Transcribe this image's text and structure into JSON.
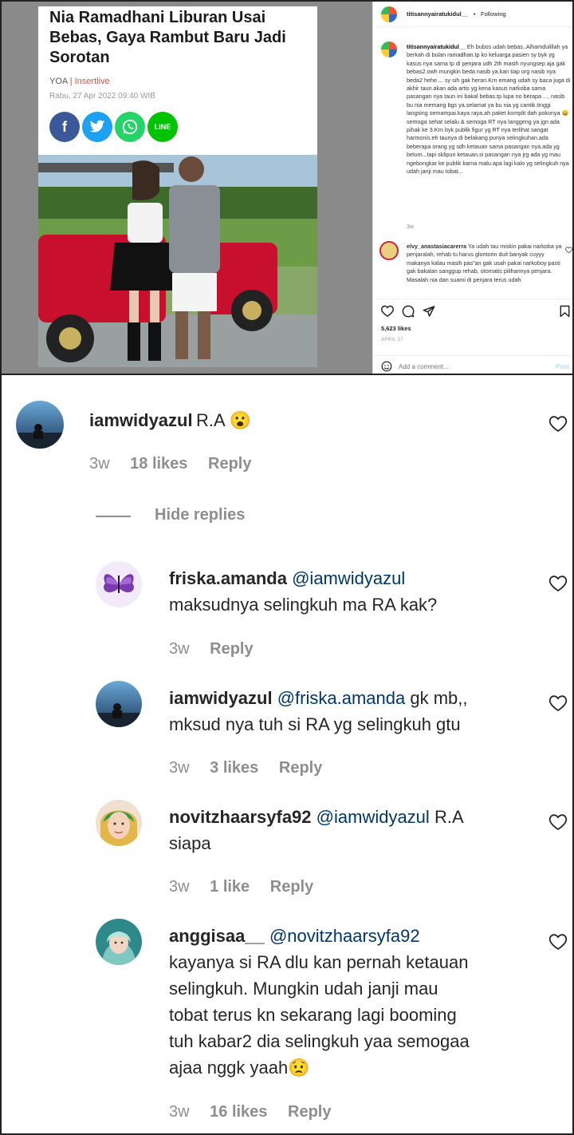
{
  "article": {
    "title": "Nia Ramadhani Liburan Usai Bebas, Gaya Rambut Baru Jadi Sorotan",
    "source": "YOA",
    "separator": "|",
    "site": "Insertlive",
    "date": "Rabu, 27 Apr 2022 09:40 WIB",
    "share_icons": [
      "facebook-icon",
      "twitter-icon",
      "whatsapp-icon",
      "line-icon"
    ],
    "share_labels": {
      "facebook": "f",
      "twitter": "t",
      "whatsapp": "w",
      "line": "LINE"
    }
  },
  "instagram_post": {
    "username": "titisannyairatukidul__",
    "dot": "•",
    "follow_status": "Following",
    "caption_user": "titisannyairatukidul__",
    "caption": "Eh bubos udah bebas..Alhamdulillah ya berkah di bulan ramadhan.tp ko keluarga pasien sy byk yg kasus nya sama tp di penjara udh 2th masih nyungsep aja gak bebas2.owh mungkin beda nasib ya.kan tiap org nasib nya beda2 hehe.... sy sih gak heran.Krn emang udah sy baca juga di akhir taun.akan ada artis yg kena kasus narkoba sama pasangan nya taun ini bakal bebas.tp lupa no berapa ..., nasib bu nia memang bgs ya.selamat ya bu nia yg cantik.tinggi langsing semampai.kaya raya.ah paket komplit dah pokonya 😀semoga sehat selalu & semoga RT nya langgeng ya jgn ada pihak ke 3.Krn byk publik figur yg RT nya terlihat sangat harmonis.eh taunya di belakang punya selingkuhan.ada beberapa orang yg sdh ketauan sama pasangan nya.ada yg belum...tapi sklipun ketauan.si pasangan nya jrg ada yg mau ngebongkar ke publik karna malu.apa lagi kalo yg selingkuh nya udah janji mau tobat...",
    "caption_time": "3w",
    "comment_user": "elvy_anastasiacarerra",
    "comment_text": "Ya udah tau miskin pakai narkoba ya penjaralah, rehab tu harus glontorin duit banyak cuyyy makanya kalau masih pas\"an gak usah pakai narkoboy pasti gak bakalan sanggup rehab, otomatis pilihannya penjara. Masalah nia dan suami di penjara terus udah",
    "likes": "5,623 likes",
    "date": "APRIL 27",
    "add_comment_placeholder": "Add a comment...",
    "post_button": "Post"
  },
  "comments": {
    "main": {
      "username": "iamwidyazul",
      "text": "R.A 😮",
      "time": "3w",
      "likes": "18 likes",
      "reply": "Reply"
    },
    "hide_replies": "Hide replies",
    "replies": [
      {
        "username": "friska.amanda",
        "mention": "@iamwidyazul",
        "lines": [
          "maksudnya selingkuh ma RA kak?"
        ],
        "time": "3w",
        "likes": "",
        "reply": "Reply"
      },
      {
        "username": "iamwidyazul",
        "mention": "@friska.amanda",
        "first": "gk mb,,",
        "lines": [
          "mksud nya tuh si RA yg selingkuh gtu"
        ],
        "time": "3w",
        "likes": "3 likes",
        "reply": "Reply"
      },
      {
        "username": "novitzhaarsyfa92",
        "mention": "@iamwidyazul",
        "first": "R.A",
        "lines": [
          "siapa"
        ],
        "time": "3w",
        "likes": "1 like",
        "reply": "Reply"
      },
      {
        "username": "anggisaa__",
        "mention": "@novitzhaarsyfa92",
        "lines": [
          "kayanya si RA dlu kan pernah ketauan",
          "selingkuh. Mungkin udah janji mau",
          "tobat terus kn sekarang lagi booming",
          "tuh kabar2 dia selingkuh yaa semogaa",
          "ajaa nggk yaah😟"
        ],
        "time": "3w",
        "likes": "16 likes",
        "reply": "Reply"
      }
    ]
  },
  "colors": {
    "mention": "#00376b",
    "meta": "#8e8e8e",
    "insertlive": "#d9534f"
  }
}
